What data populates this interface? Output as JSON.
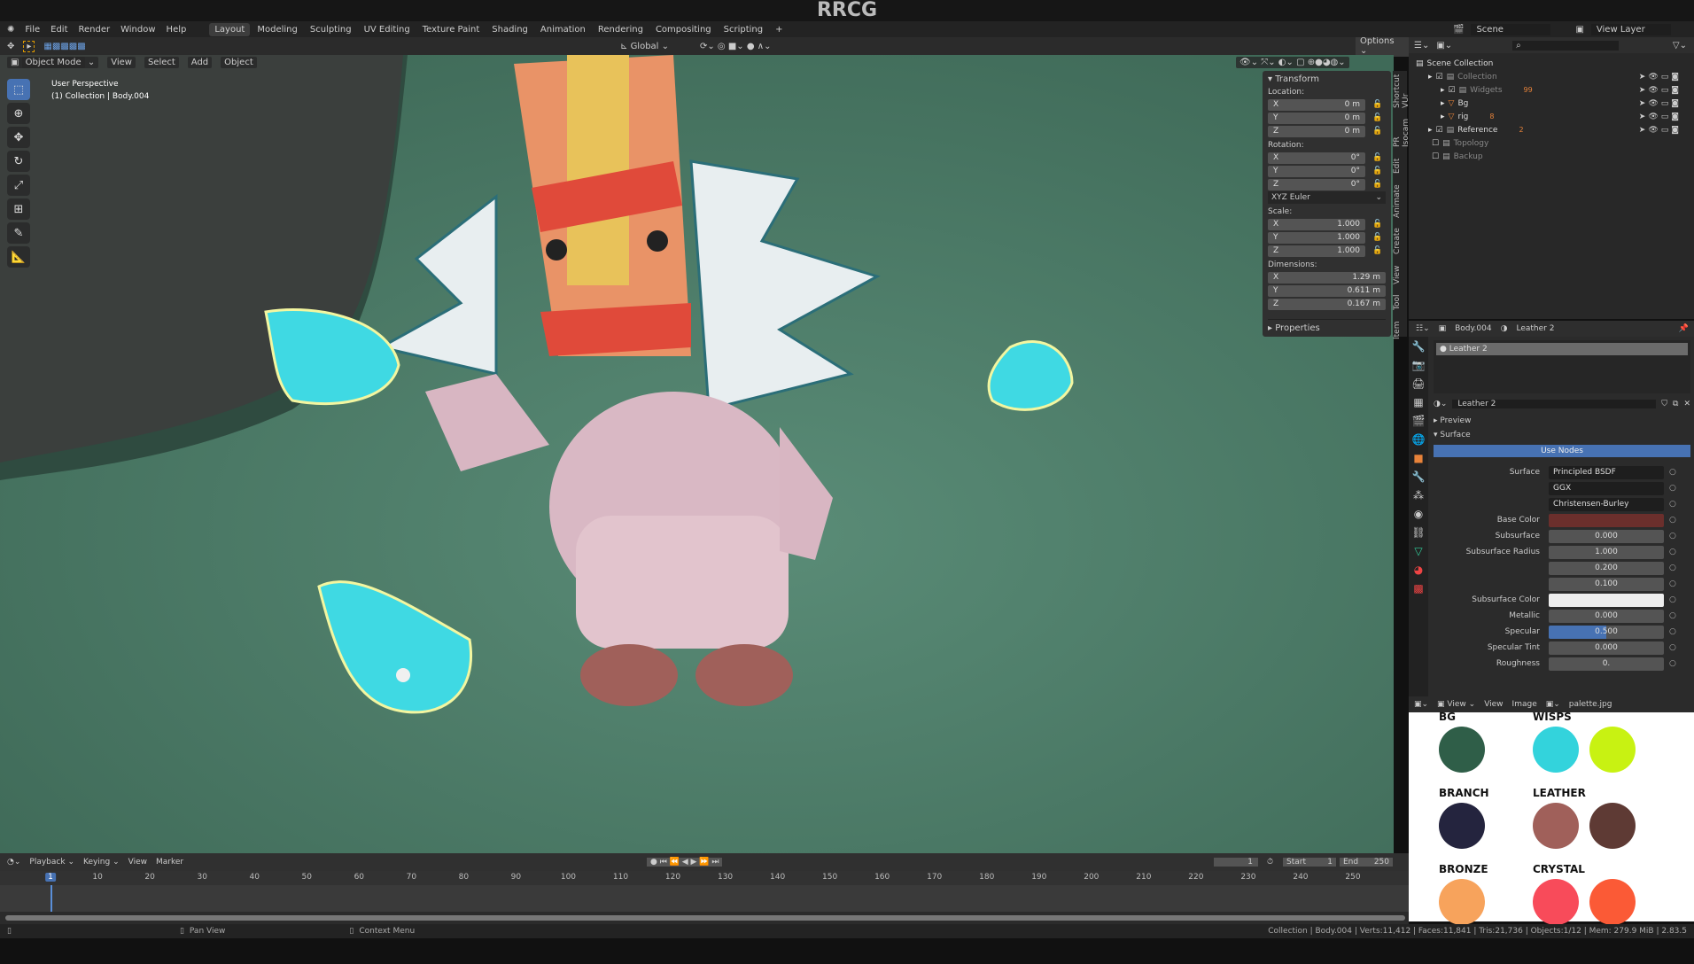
{
  "watermark_title": "RRCG",
  "menu": [
    "File",
    "Edit",
    "Render",
    "Window",
    "Help"
  ],
  "workspaces": [
    "Layout",
    "Modeling",
    "Sculpting",
    "UV Editing",
    "Texture Paint",
    "Shading",
    "Animation",
    "Rendering",
    "Compositing",
    "Scripting",
    "+"
  ],
  "active_workspace": "Layout",
  "scene": "Scene",
  "view_layer": "View Layer",
  "header": {
    "orientation": "Global",
    "options": "Options"
  },
  "viewport": {
    "mode": "Object Mode",
    "menus": [
      "View",
      "Select",
      "Add",
      "Object"
    ],
    "perspective": "User Perspective",
    "context": "(1) Collection | Body.004"
  },
  "tools": [
    "select-box",
    "cursor",
    "move",
    "rotate",
    "scale",
    "transform",
    "annotate",
    "measure"
  ],
  "npanel": {
    "transform_title": "Transform",
    "location_label": "Location:",
    "location": [
      {
        "axis": "X",
        "value": "0 m"
      },
      {
        "axis": "Y",
        "value": "0 m"
      },
      {
        "axis": "Z",
        "value": "0 m"
      }
    ],
    "rotation_label": "Rotation:",
    "rotation": [
      {
        "axis": "X",
        "value": "0°"
      },
      {
        "axis": "Y",
        "value": "0°"
      },
      {
        "axis": "Z",
        "value": "0°"
      }
    ],
    "rotation_mode": "XYZ Euler",
    "scale_label": "Scale:",
    "scale": [
      {
        "axis": "X",
        "value": "1.000"
      },
      {
        "axis": "Y",
        "value": "1.000"
      },
      {
        "axis": "Z",
        "value": "1.000"
      }
    ],
    "dimensions_label": "Dimensions:",
    "dimensions": [
      {
        "axis": "X",
        "value": "1.29 m"
      },
      {
        "axis": "Y",
        "value": "0.611 m"
      },
      {
        "axis": "Z",
        "value": "0.167 m"
      }
    ],
    "properties_title": "Properties",
    "tabs": [
      "Item",
      "Tool",
      "View",
      "Create",
      "Animate",
      "Edit",
      "PR Isocam",
      "Shortcut VUr"
    ]
  },
  "outliner": {
    "root": "Scene Collection",
    "items": [
      {
        "name": "Collection",
        "indent": 1,
        "checked": true,
        "badge": ""
      },
      {
        "name": "Widgets",
        "indent": 2,
        "checked": true,
        "badge": "99"
      },
      {
        "name": "Bg",
        "indent": 2,
        "checked": null,
        "badge": ""
      },
      {
        "name": "rig",
        "indent": 2,
        "checked": null,
        "badge": "8"
      },
      {
        "name": "Reference",
        "indent": 1,
        "checked": true,
        "badge": "2"
      },
      {
        "name": "Topology",
        "indent": 1,
        "checked": false,
        "badge": ""
      },
      {
        "name": "Backup",
        "indent": 1,
        "checked": false,
        "badge": ""
      }
    ]
  },
  "properties": {
    "object": "Body.004",
    "material": "Leather 2",
    "slot": "Leather 2",
    "datablock": "Leather 2",
    "preview": "Preview",
    "surface_section": "Surface",
    "use_nodes": "Use Nodes",
    "rows": [
      {
        "label": "Surface",
        "value": "Principled BSDF",
        "type": "dark"
      },
      {
        "label": "",
        "value": "GGX",
        "type": "dark"
      },
      {
        "label": "",
        "value": "Christensen-Burley",
        "type": "dark"
      },
      {
        "label": "Base Color",
        "value": "",
        "type": "color",
        "color": "#6b2f2c"
      },
      {
        "label": "Subsurface",
        "value": "0.000",
        "type": "num"
      },
      {
        "label": "Subsurface Radius",
        "value": "1.000",
        "type": "num"
      },
      {
        "label": "",
        "value": "0.200",
        "type": "num"
      },
      {
        "label": "",
        "value": "0.100",
        "type": "num"
      },
      {
        "label": "Subsurface Color",
        "value": "",
        "type": "color",
        "color": "#eeeeee"
      },
      {
        "label": "Metallic",
        "value": "0.000",
        "type": "num"
      },
      {
        "label": "Specular",
        "value": "0.500",
        "type": "slider",
        "fill": 0.5
      },
      {
        "label": "Specular Tint",
        "value": "0.000",
        "type": "num"
      },
      {
        "label": "Roughness",
        "value": "0.",
        "type": "num"
      }
    ]
  },
  "image_editor": {
    "menus": [
      "View",
      "View",
      "Image"
    ],
    "image": "palette.jpg",
    "swatches": [
      {
        "title": "BG",
        "colors": [
          "#2f5e48"
        ]
      },
      {
        "title": "WISPS",
        "colors": [
          "#33d3dc",
          "#c8f212"
        ]
      },
      {
        "title": "BRANCH",
        "colors": [
          "#24243e"
        ]
      },
      {
        "title": "LEATHER",
        "colors": [
          "#a0605a",
          "#5e3a34"
        ]
      },
      {
        "title": "BRONZE",
        "colors": [
          "#f7a35c"
        ]
      },
      {
        "title": "CRYSTAL",
        "colors": [
          "#f84b5a",
          "#fb5a36"
        ]
      }
    ]
  },
  "timeline": {
    "menus": [
      "Playback",
      "Keying",
      "View",
      "Marker"
    ],
    "current": "1",
    "start_label": "Start",
    "start": "1",
    "end_label": "End",
    "end": "250",
    "ticks": [
      "1",
      "10",
      "20",
      "30",
      "40",
      "50",
      "60",
      "70",
      "80",
      "90",
      "100",
      "110",
      "120",
      "130",
      "140",
      "150",
      "160",
      "170",
      "180",
      "190",
      "200",
      "210",
      "220",
      "230",
      "240",
      "250"
    ]
  },
  "status": {
    "pan": "Pan View",
    "context": "Context Menu",
    "info": "Collection | Body.004 | Verts:11,412 | Faces:11,841 | Tris:21,736 | Objects:1/12 | Mem: 279.9 MiB | 2.83.5"
  }
}
